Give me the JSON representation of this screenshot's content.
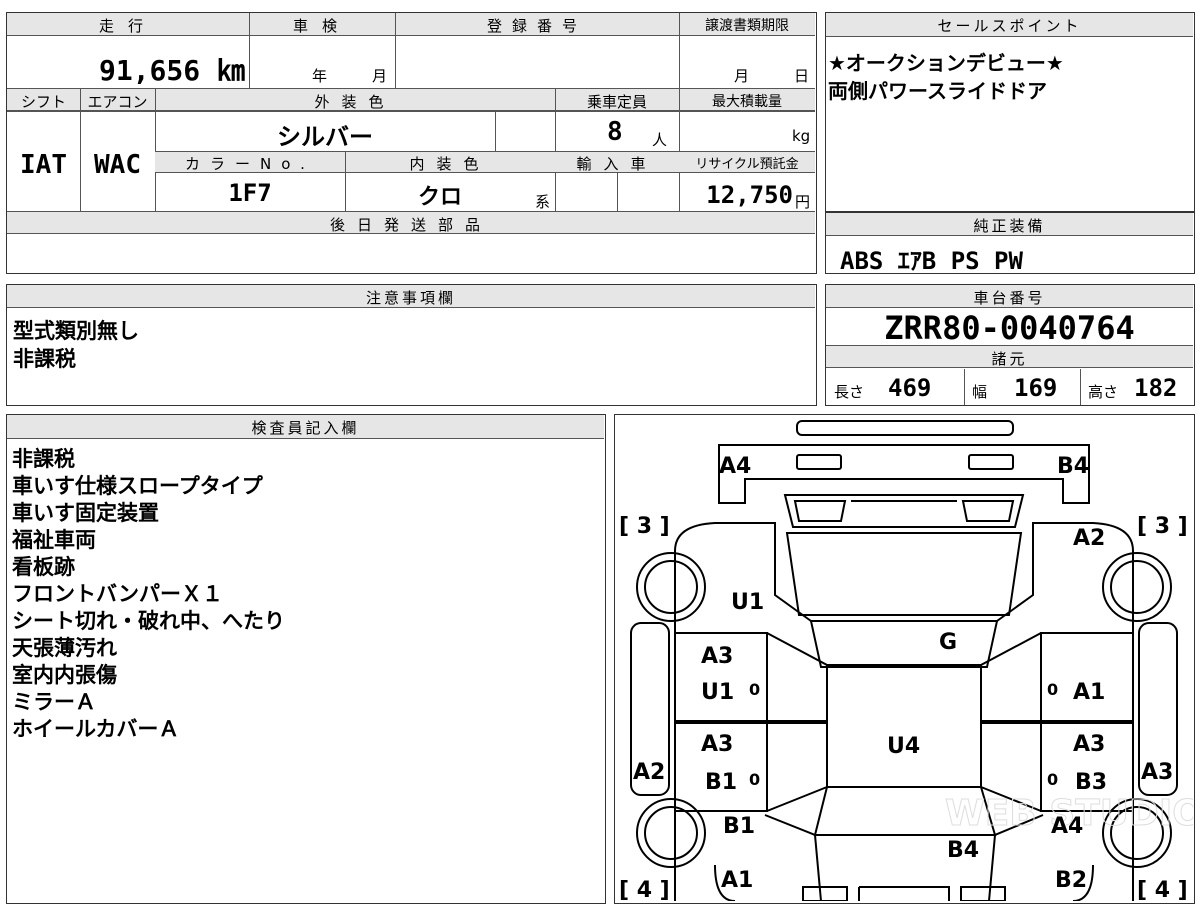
{
  "vehicle": {
    "mileage_label": "走行",
    "mileage": "91,656 ㎞",
    "inspection_label": "車検",
    "year_unit": "年",
    "month_unit": "月",
    "registration_label": "登録番号",
    "registration_value": "",
    "transfer_deadline_label": "譲渡書類期限",
    "day_unit": "日",
    "shift_label": "シフト",
    "shift": "IAT",
    "ac_label": "エアコン",
    "ac": "WAC",
    "exterior_color_label": "外装色",
    "exterior_color": "シルバー",
    "capacity_label": "乗車定員",
    "capacity": "8",
    "capacity_unit": "人",
    "max_load_label": "最大積載量",
    "max_load_unit": "kg",
    "color_no_label": "カラーNo.",
    "color_no": "1F7",
    "interior_color_label": "内装色",
    "interior_color": "クロ",
    "interior_suffix": "系",
    "import_label": "輸入車",
    "recycle_label": "リサイクル預託金",
    "recycle_fee": "12,750",
    "yen_unit": "円",
    "later_parts_label": "後日発送部品"
  },
  "sales_points": {
    "label": "セールスポイント",
    "lines": [
      "★オークションデビュー★",
      "両側パワースライドドア"
    ]
  },
  "equipment": {
    "label": "純正装備",
    "value": "ABS ｴｱB PS PW"
  },
  "notes": {
    "label": "注意事項欄",
    "lines": [
      "型式類別無し",
      "非課税"
    ]
  },
  "chassis": {
    "label": "車台番号",
    "value": "ZRR80-0040764",
    "specs_label": "諸元",
    "length_label": "長さ",
    "length": "469",
    "width_label": "幅",
    "width": "169",
    "height_label": "高さ",
    "height": "182"
  },
  "inspector": {
    "label": "検査員記入欄",
    "lines": [
      "非課税",
      "車いす仕様スロープタイプ",
      "車いす固定装置",
      "福祉車両",
      "看板跡",
      "フロントバンパーＸ１",
      "シート切れ・破れ中、へたり",
      "天張薄汚れ",
      "室内内張傷",
      "ミラーＡ",
      "ホイールカバーＡ"
    ]
  },
  "diagram": {
    "marks": {
      "a4": "A4",
      "b4_top": "B4",
      "tire_fl": "[ 3 ]",
      "tire_fr": "[ 3 ]",
      "a2_right": "A2",
      "u1_hood": "U1",
      "g_glass": "G",
      "a3_lf": "A3",
      "u1_lf": "U1",
      "zero_lf": "0",
      "zero_rf": "0",
      "a1_rf": "A1",
      "a3_lr": "A3",
      "b1_lr": "B1",
      "zero_lr": "0",
      "a3_rr": "A3",
      "zero_rr": "0",
      "b3_rr": "B3",
      "u4_roof": "U4",
      "a2_left": "A2",
      "a3_right": "A3",
      "b1_rear": "B1",
      "a4_rear": "A4",
      "b4_rear": "B4",
      "a1_rear": "A1",
      "b2_rear": "B2",
      "tire_rl": "[ 4 ]",
      "tire_rr": "[ 4 ]"
    },
    "watermark": "WEB STUDIO"
  }
}
